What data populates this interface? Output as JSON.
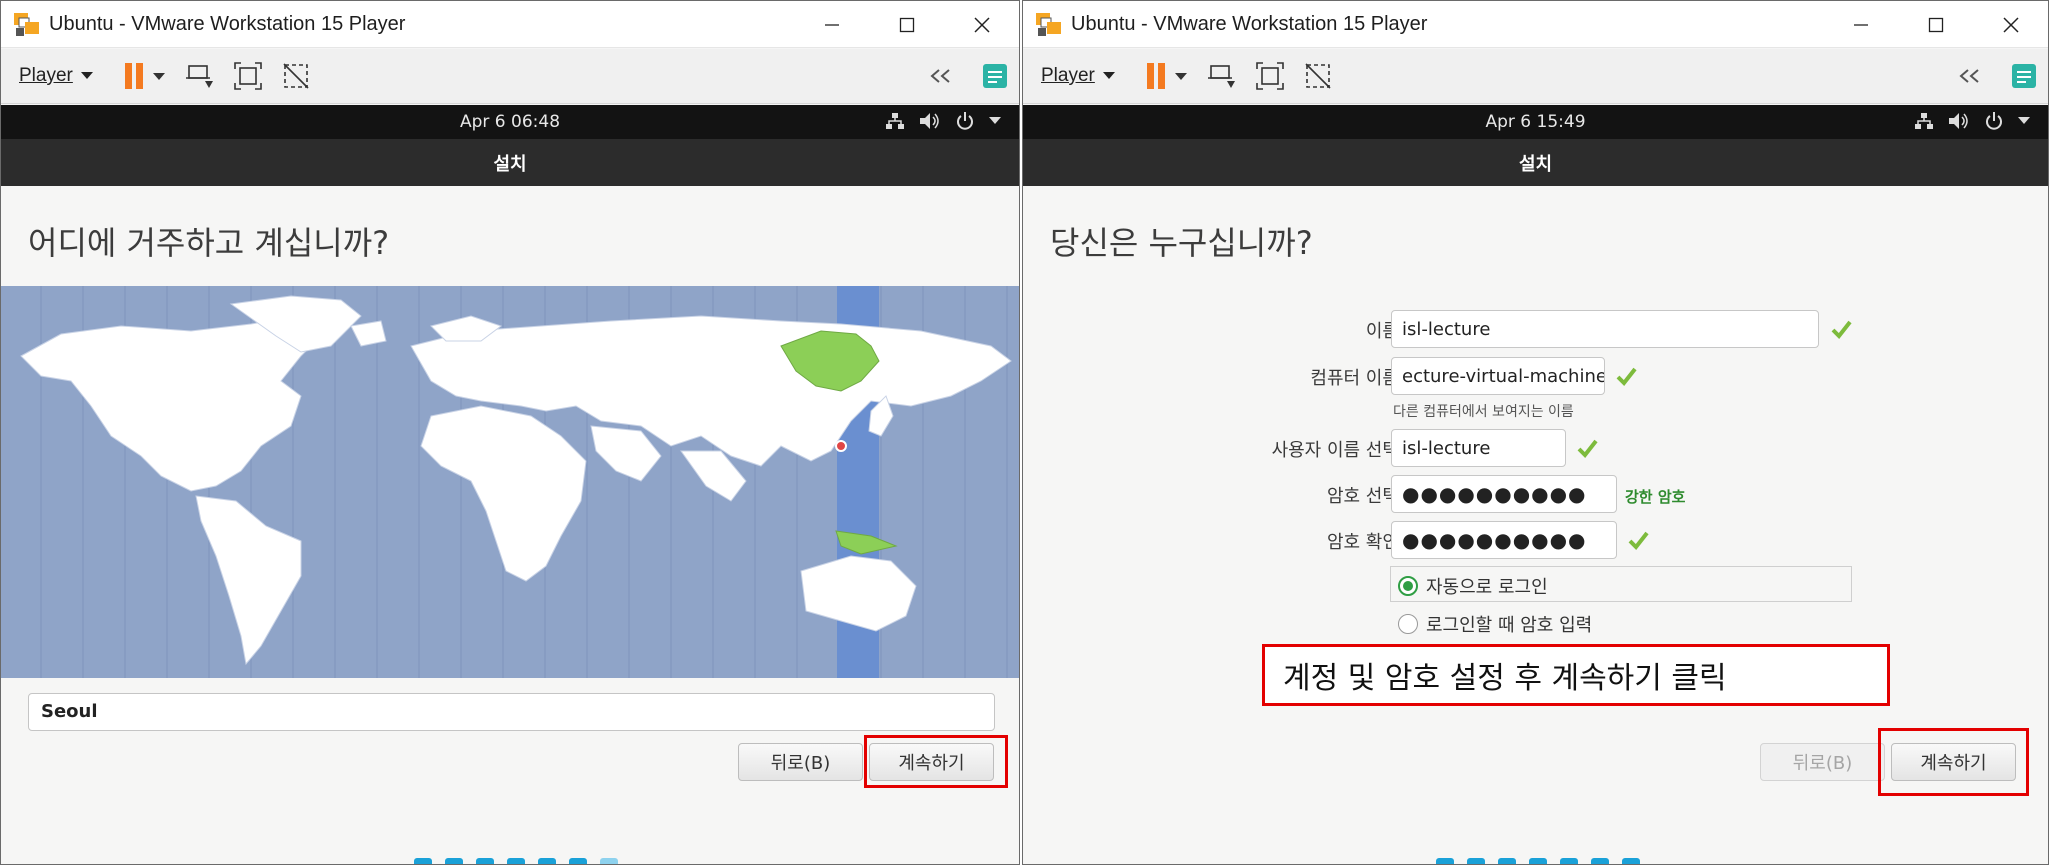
{
  "left": {
    "window_title": "Ubuntu - VMware Workstation 15 Player",
    "player_menu": "Player",
    "clock": "Apr 6  06:48",
    "header": "설치",
    "heading": "어디에 거주하고 계십니까?",
    "city_value": "Seoul",
    "back_label": "뒤로(B)",
    "continue_label": "계속하기",
    "progress": {
      "total": 7,
      "done": 6
    }
  },
  "right": {
    "window_title": "Ubuntu - VMware Workstation 15 Player",
    "player_menu": "Player",
    "clock": "Apr 6  15:49",
    "header": "설치",
    "heading": "당신은 누구십니까?",
    "form": {
      "name_label": "이름:",
      "name_value": "isl-lecture",
      "computer_label": "컴퓨터 이름:",
      "computer_value": "ecture-virtual-machine",
      "computer_hint": "다른 컴퓨터에서 보여지는 이름",
      "username_label": "사용자 이름 선택:",
      "username_value": "isl-lecture",
      "password_label": "암호 선택:",
      "password_value": "●●●●●●●●●●",
      "password_strength": "강한 암호",
      "confirm_label": "암호 확인:",
      "confirm_value": "●●●●●●●●●●",
      "auto_login": "자동으로 로그인",
      "require_password": "로그인할 때 암호 입력"
    },
    "annotation": "계정 및 암호 설정 후 계속하기 클릭",
    "back_label": "뒤로(B)",
    "continue_label": "계속하기",
    "progress": {
      "total": 7,
      "done": 7
    }
  },
  "colors": {
    "highlight": "#e30000",
    "header_dark": "#2c2c2c",
    "selected_zone": "#6a8fd0",
    "selected_country": "#8ccf57",
    "progress": "#1aa1d8",
    "strong_password": "#2e8b2e"
  }
}
